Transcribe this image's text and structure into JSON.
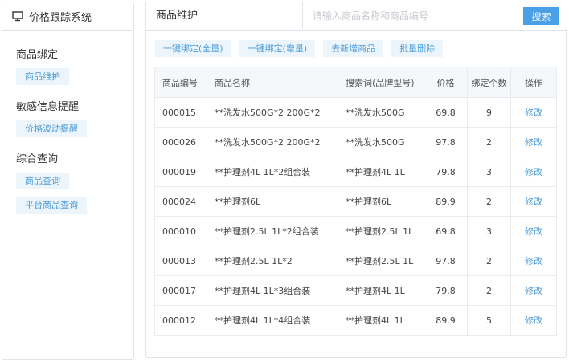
{
  "sidebar": {
    "title": "价格跟踪系统",
    "groups": [
      {
        "title": "商品绑定",
        "items": [
          {
            "label": "商品维护"
          }
        ]
      },
      {
        "title": "敏感信息提醒",
        "items": [
          {
            "label": "价格波动提醒"
          }
        ]
      },
      {
        "title": "综合查询",
        "items": [
          {
            "label": "商品查询"
          },
          {
            "label": "平台商品查询"
          }
        ]
      }
    ]
  },
  "main": {
    "title": "商品维护",
    "search": {
      "placeholder": "请输入商品名称和商品编号",
      "value": "",
      "button_label": "搜索"
    },
    "toolbar": {
      "bind_all": "一键绑定(全量)",
      "bind_incremental": "一键绑定(增量)",
      "add_product": "去新增商品",
      "batch_delete": "批量删除"
    },
    "table": {
      "columns": {
        "code": "商品编号",
        "name": "商品名称",
        "keyword": "搜索词(品牌型号)",
        "price": "价格",
        "bound_count": "绑定个数",
        "action": "操作"
      },
      "rows": [
        {
          "code": "000015",
          "name": "**洗发水500G*2 200G*2",
          "keyword": "**洗发水500G",
          "price": "69.8",
          "bound_count": "9",
          "action": "修改"
        },
        {
          "code": "000026",
          "name": "**洗发水500G*2 200G*2",
          "keyword": "**洗发水500G",
          "price": "97.8",
          "bound_count": "2",
          "action": "修改"
        },
        {
          "code": "000019",
          "name": "**护理剂4L 1L*2组合装",
          "keyword": "**护理剂4L 1L",
          "price": "79.8",
          "bound_count": "3",
          "action": "修改"
        },
        {
          "code": "000024",
          "name": "**护理剂6L",
          "keyword": "**护理剂6L",
          "price": "89.9",
          "bound_count": "2",
          "action": "修改"
        },
        {
          "code": "000010",
          "name": "**护理剂2.5L 1L*2组合装",
          "keyword": "**护理剂2.5L 1L",
          "price": "69.8",
          "bound_count": "3",
          "action": "修改"
        },
        {
          "code": "000013",
          "name": "**护理剂2.5L 1L*2",
          "keyword": "**护理剂2.5L 1L",
          "price": "97.8",
          "bound_count": "2",
          "action": "修改"
        },
        {
          "code": "000017",
          "name": "**护理剂4L 1L*3组合装",
          "keyword": "**护理剂4L 1L",
          "price": "79.8",
          "bound_count": "2",
          "action": "修改"
        },
        {
          "code": "000012",
          "name": "**护理剂4L 1L*4组合装",
          "keyword": "**护理剂4L 1L",
          "price": "89.9",
          "bound_count": "5",
          "action": "修改"
        }
      ]
    }
  },
  "colors": {
    "accent": "#4aa0e6",
    "link": "#4a9bd8",
    "chip_bg": "#edf5fc",
    "border": "#dfe4ea"
  },
  "icons": {
    "sidebar_header": "monitor-icon"
  }
}
